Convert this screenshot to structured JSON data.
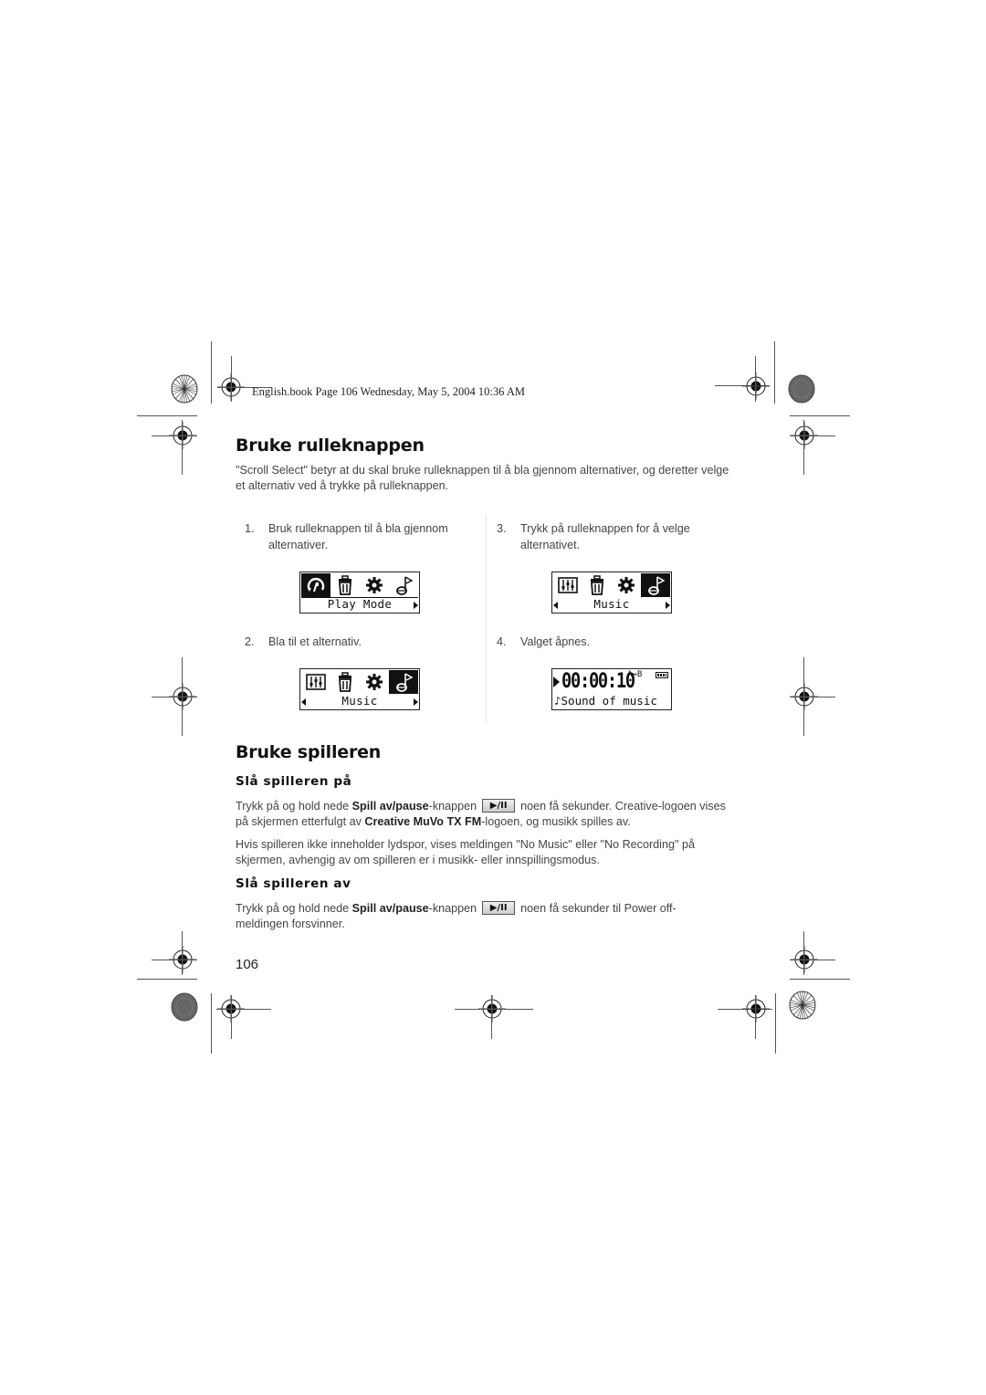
{
  "header_stamp": "English.book  Page 106  Wednesday, May 5, 2004  10:36 AM",
  "section1": {
    "title": "Bruke rulleknappen",
    "intro": "\"Scroll Select\" betyr at du skal bruke rulleknappen til å bla gjennom alternativer, og deretter velge et alternativ ved å trykke på rulleknappen.",
    "steps": [
      {
        "num": "1.",
        "text": "Bruk rulleknappen til å bla gjennom alternativer."
      },
      {
        "num": "2.",
        "text": "Bla til et alternativ."
      },
      {
        "num": "3.",
        "text": "Trykk på rulleknappen for å velge alternativet."
      },
      {
        "num": "4.",
        "text": "Valget åpnes."
      }
    ],
    "screens": [
      {
        "label": "Play Mode",
        "icons": [
          "play-mode-icon",
          "trash-icon",
          "settings-gear-icon",
          "music-note-icon"
        ],
        "selected": 0,
        "left_arrow": false,
        "right_arrow": true
      },
      {
        "label": "Music",
        "icons": [
          "equalizer-icon",
          "trash-icon",
          "settings-gear-icon",
          "music-note-icon"
        ],
        "selected": 3,
        "left_arrow": true,
        "right_arrow": true
      },
      {
        "label": "Music",
        "icons": [
          "equalizer-icon",
          "trash-icon",
          "settings-gear-icon",
          "music-note-icon"
        ],
        "selected": 3,
        "left_arrow": true,
        "right_arrow": true
      },
      {
        "time": "00:00:10",
        "repeat": "A↔B",
        "song": "♪Sound of music",
        "battery": "full"
      }
    ]
  },
  "section2": {
    "title": "Bruke spilleren",
    "on": {
      "title": "Slå spilleren på",
      "p1_pre": "Trykk på og hold nede ",
      "p1_bold1": "Spill av/pause",
      "p1_mid": "-knappen",
      "button_glyph": "▶/II",
      "p1_post": "noen få sekunder. Creative-logoen vises på skjermen etterfulgt av ",
      "p1_bold2": "Creative MuVo TX FM",
      "p1_end": "-logoen, og musikk spilles av.",
      "p2": "Hvis spilleren ikke inneholder lydspor, vises meldingen \"No Music\" eller \"No Recording\" på skjermen, avhengig av om spilleren er i musikk- eller innspillingsmodus."
    },
    "off": {
      "title": "Slå spilleren av",
      "p1_pre": "Trykk på og hold nede ",
      "p1_bold1": "Spill av/pause",
      "p1_mid": "-knappen",
      "button_glyph": "▶/II",
      "p1_post": "noen få sekunder til Power off-meldingen forsvinner."
    }
  },
  "page_number": "106"
}
